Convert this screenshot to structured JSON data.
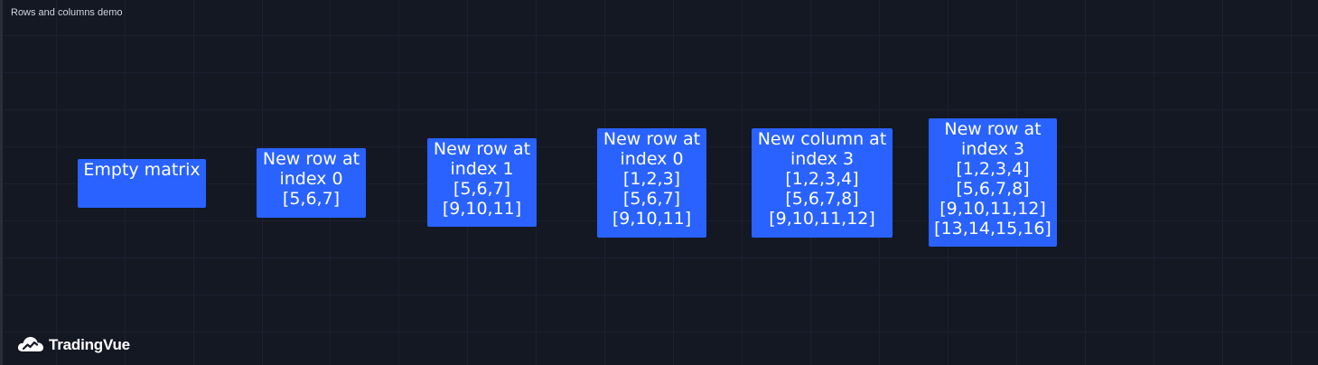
{
  "chart": {
    "title": "Rows and columns demo"
  },
  "labels": [
    {
      "lines": [
        "Empty matrix"
      ]
    },
    {
      "lines": [
        "New row at",
        "index 0",
        "[5,6,7]"
      ]
    },
    {
      "lines": [
        "New row at",
        "index 1",
        "[5,6,7]",
        "[9,10,11]"
      ]
    },
    {
      "lines": [
        "New row at",
        "index 0",
        "[1,2,3]",
        "[5,6,7]",
        "[9,10,11]"
      ]
    },
    {
      "lines": [
        "New column at",
        "index 3",
        "[1,2,3,4]",
        "[5,6,7,8]",
        "[9,10,11,12]"
      ]
    },
    {
      "lines": [
        "New row at",
        "index 3",
        "[1,2,3,4]",
        "[5,6,7,8]",
        "[9,10,11,12]",
        "[13,14,15,16]"
      ]
    }
  ],
  "logo": {
    "text": "TradingVue",
    "icon": "tradingvue-cloud-icon"
  },
  "colors": {
    "background": "#141823",
    "grid": "#1c2030",
    "label": "#2962ff",
    "text": "#ffffff"
  }
}
